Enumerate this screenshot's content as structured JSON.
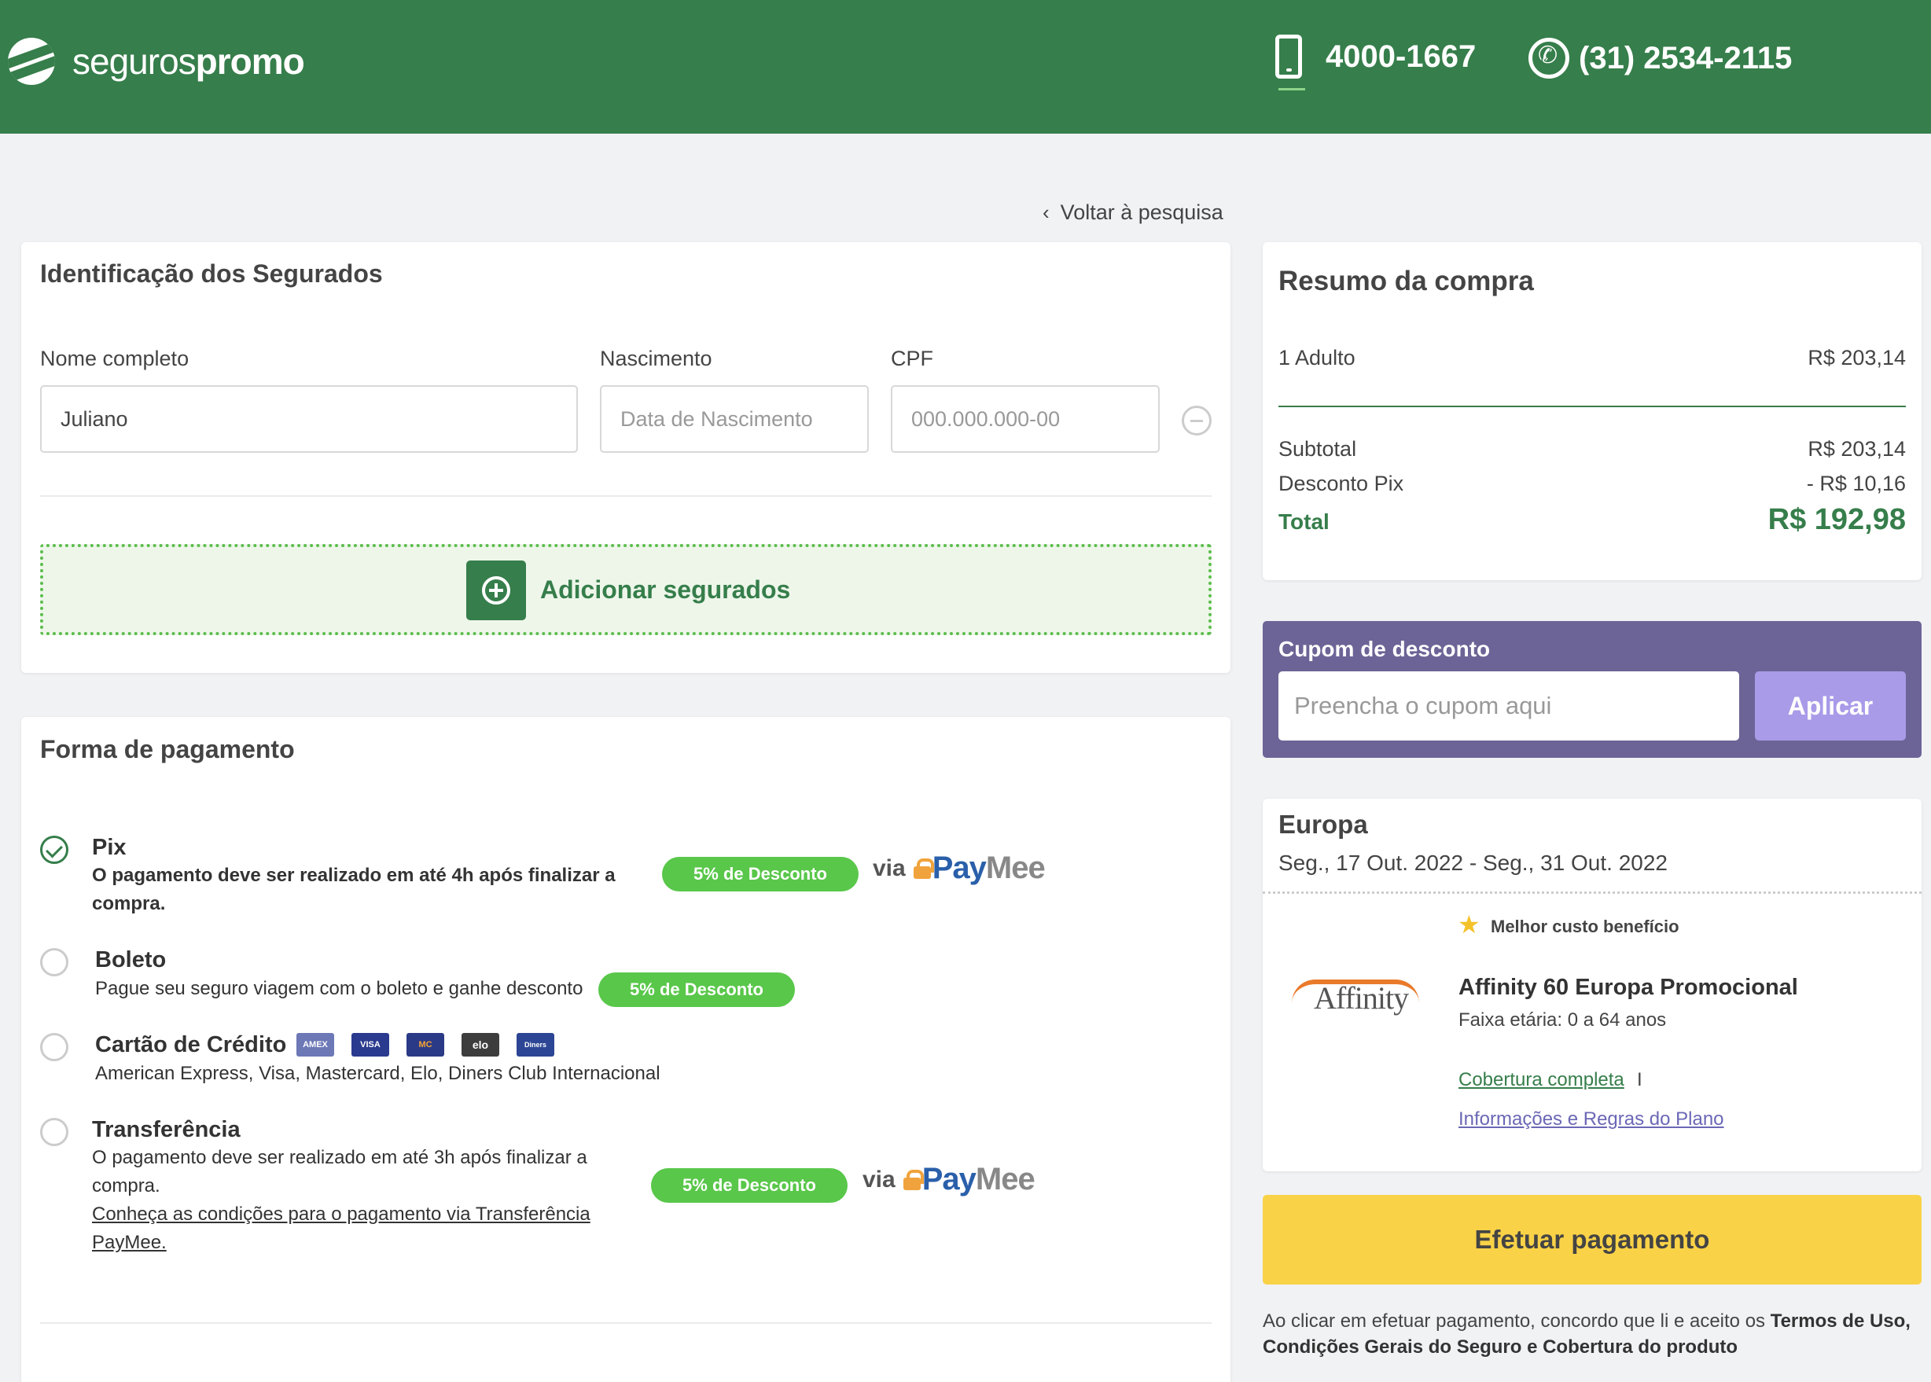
{
  "header": {
    "logo_light": "seguros",
    "logo_bold": "promo",
    "phone": "4000-1667",
    "whatsapp": "(31) 2534-2115"
  },
  "nav": {
    "back_label": "Voltar à pesquisa"
  },
  "insured": {
    "title": "Identificação dos Segurados",
    "name_label": "Nome completo",
    "name_value": "Juliano",
    "birth_label": "Nascimento",
    "birth_placeholder": "Data de Nascimento",
    "cpf_label": "CPF",
    "cpf_placeholder": "000.000.000-00",
    "add_label": "Adicionar segurados"
  },
  "payment": {
    "title": "Forma de pagamento",
    "via": "via",
    "paymee_pay": "Pay",
    "paymee_mee": "Mee",
    "options": [
      {
        "title": "Pix",
        "desc_line1": "O pagamento deve ser realizado em até 4h após finalizar a",
        "desc_line2": "compra.",
        "badge": "5% de Desconto",
        "selected": true
      },
      {
        "title": "Boleto",
        "desc_line1": "Pague seu seguro viagem com o boleto e ganhe desconto",
        "badge": "5% de Desconto",
        "selected": false
      },
      {
        "title": "Cartão de Crédito",
        "desc_line1": "American Express, Visa, Mastercard, Elo, Diners Club Internacional",
        "selected": false
      },
      {
        "title": "Transferência",
        "desc_line1": "O pagamento deve ser realizado em até 3h após finalizar a",
        "desc_line2": "compra.",
        "link_line1": "Conheça as condições para o pagamento via Transferência",
        "link_line2": "PayMee.",
        "badge": "5% de Desconto",
        "selected": false
      }
    ],
    "card_brands": [
      "AMEX",
      "VISA",
      "MC",
      "elo",
      "Diners"
    ]
  },
  "summary": {
    "title": "Resumo da compra",
    "adult_label": "1 Adulto",
    "adult_value": "R$ 203,14",
    "subtotal_label": "Subtotal",
    "subtotal_value": "R$ 203,14",
    "discount_label": "Desconto Pix",
    "discount_value": "- R$ 10,16",
    "total_label": "Total",
    "total_value": "R$ 192,98"
  },
  "coupon": {
    "title": "Cupom de desconto",
    "placeholder": "Preencha o cupom aqui",
    "apply_label": "Aplicar"
  },
  "plan": {
    "destination": "Europa",
    "dates": "Seg., 17 Out. 2022 - Seg., 31 Out. 2022",
    "best_label": "Melhor custo benefício",
    "insurer_logo_text": "Affinity",
    "name": "Affinity 60 Europa Promocional",
    "age_range": "Faixa etária: 0 a 64 anos",
    "coverage_link": "Cobertura completa",
    "separator": "I",
    "rules_link": "Informações e Regras do Plano"
  },
  "checkout": {
    "pay_label": "Efetuar pagamento",
    "terms_text": "Ao clicar em efetuar pagamento, concordo que li e aceito os ",
    "terms_bold": "Termos de Uso, Condições Gerais do Seguro e Cobertura do produto"
  },
  "colors": {
    "brand_green": "#367e4b",
    "badge_green": "#59c74a",
    "coupon_purple": "#6c6496",
    "pay_yellow": "#f9d247"
  }
}
